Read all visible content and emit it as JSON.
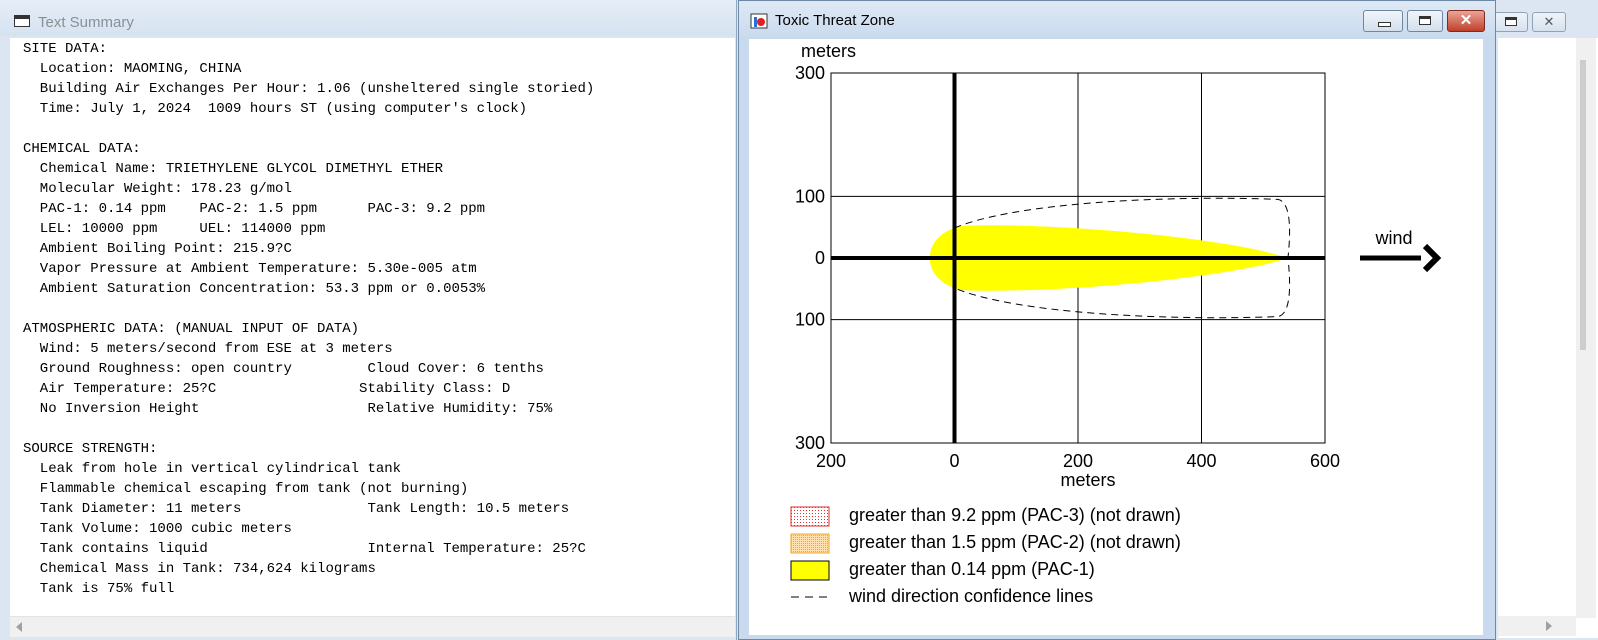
{
  "text_summary": {
    "title": "Text Summary",
    "lines": [
      "SITE DATA:",
      "  Location: MAOMING, CHINA",
      "  Building Air Exchanges Per Hour: 1.06 (unsheltered single storied)",
      "  Time: July 1, 2024  1009 hours ST (using computer's clock)",
      "",
      "CHEMICAL DATA:",
      "  Chemical Name: TRIETHYLENE GLYCOL DIMETHYL ETHER",
      "  Molecular Weight: 178.23 g/mol",
      "  PAC-1: 0.14 ppm    PAC-2: 1.5 ppm      PAC-3: 9.2 ppm",
      "  LEL: 10000 ppm     UEL: 114000 ppm",
      "  Ambient Boiling Point: 215.9?C",
      "  Vapor Pressure at Ambient Temperature: 5.30e-005 atm",
      "  Ambient Saturation Concentration: 53.3 ppm or 0.0053%",
      "",
      "ATMOSPHERIC DATA: (MANUAL INPUT OF DATA)",
      "  Wind: 5 meters/second from ESE at 3 meters",
      "  Ground Roughness: open country         Cloud Cover: 6 tenths",
      "  Air Temperature: 25?C                 Stability Class: D",
      "  No Inversion Height                    Relative Humidity: 75%",
      "",
      "SOURCE STRENGTH:",
      "  Leak from hole in vertical cylindrical tank",
      "  Flammable chemical escaping from tank (not burning)",
      "  Tank Diameter: 11 meters               Tank Length: 10.5 meters",
      "  Tank Volume: 1000 cubic meters",
      "  Tank contains liquid                   Internal Temperature: 25?C",
      "  Chemical Mass in Tank: 734,624 kilograms",
      "  Tank is 75% full"
    ]
  },
  "threat_zone": {
    "title": "Toxic Threat Zone",
    "window_buttons": [
      "minimize",
      "maximize",
      "close"
    ],
    "y_unit_label": "meters",
    "x_unit_label": "meters",
    "wind_label": "wind",
    "legend": [
      {
        "label": "greater than 9.2 ppm (PAC-3) (not drawn)",
        "swatch": "red-dotted"
      },
      {
        "label": "greater than 1.5 ppm (PAC-2) (not drawn)",
        "swatch": "orange-dotted"
      },
      {
        "label": "greater than 0.14 ppm (PAC-1)",
        "swatch": "yellow"
      },
      {
        "label": "wind direction confidence lines",
        "swatch": "dashed-line"
      }
    ],
    "colors": {
      "pac1": "#ffff00",
      "pac2": "#f5a623",
      "pac3": "#e03030",
      "axis": "#000000"
    }
  },
  "chart_data": {
    "type": "area",
    "x_ticks": [
      "200",
      "0",
      "200",
      "400",
      "600"
    ],
    "y_ticks": [
      "300",
      "100",
      "0",
      "100",
      "300"
    ],
    "xlim": [
      -200,
      600
    ],
    "ylim": [
      -300,
      300
    ],
    "grid": true,
    "series": [
      {
        "name": "greater than 0.14 ppm (PAC-1)",
        "downwind_extent_m": 540,
        "upwind_extent_m": -40,
        "max_halfwidth_m": 55
      },
      {
        "name": "wind direction confidence lines",
        "downwind_extent_m": 540,
        "max_halfwidth_m": 100
      }
    ]
  }
}
